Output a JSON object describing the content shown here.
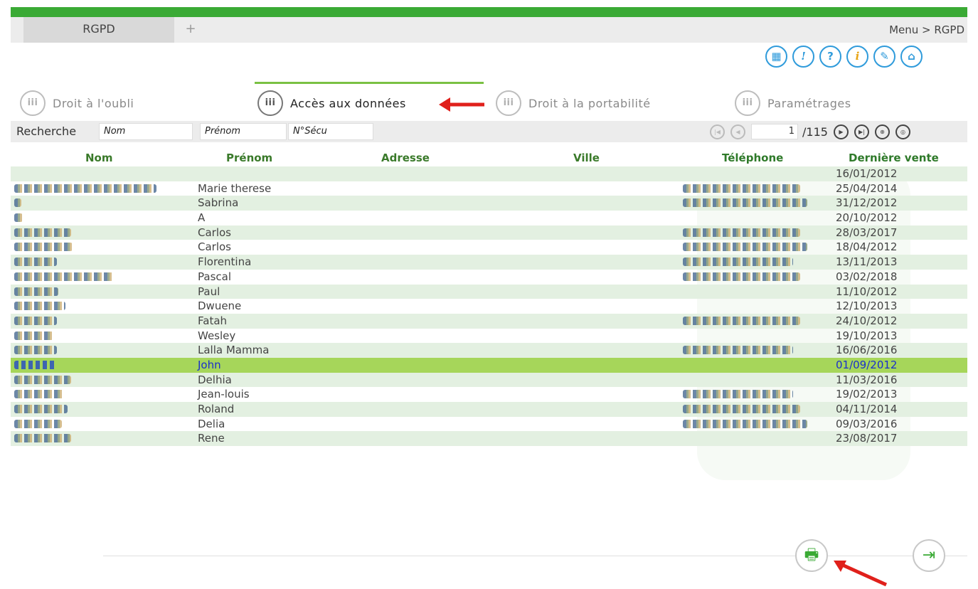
{
  "window": {
    "tab_label": "RGPD",
    "add_tab": "+",
    "breadcrumb": "Menu > RGPD"
  },
  "toolbar_icons": [
    "calendar-icon",
    "alert-icon",
    "help-icon",
    "info-icon",
    "tools-icon",
    "home-icon"
  ],
  "nav_tabs": [
    {
      "label": "Droit à l'oubli",
      "icon": "group-icon",
      "active": false
    },
    {
      "label": "Accès aux données",
      "icon": "group-icon",
      "active": true
    },
    {
      "label": "Droit à la portabilité",
      "icon": "group-icon",
      "active": false
    },
    {
      "label": "Paramétrages",
      "icon": "group-icon",
      "active": false
    }
  ],
  "search": {
    "label": "Recherche",
    "nom_placeholder": "Nom",
    "prenom_placeholder": "Prénom",
    "secu_placeholder": "N°Sécu"
  },
  "pager": {
    "current": "1",
    "total": "/115"
  },
  "table": {
    "columns": [
      "Nom",
      "Prénom",
      "Adresse",
      "Ville",
      "Téléphone",
      "Dernière vente"
    ],
    "rows": [
      {
        "nom": "",
        "prenom": "",
        "tel": "",
        "vente": "16/01/2012"
      },
      {
        "nom": "redacted",
        "prenom": "Marie therese",
        "tel": "redacted",
        "vente": "25/04/2014"
      },
      {
        "nom": "redacted",
        "prenom": "Sabrina",
        "tel": "redacted",
        "vente": "31/12/2012"
      },
      {
        "nom": "redacted",
        "prenom": "A",
        "tel": "",
        "vente": "20/10/2012"
      },
      {
        "nom": "redacted",
        "prenom": "Carlos",
        "tel": "redacted",
        "vente": "28/03/2017"
      },
      {
        "nom": "redacted",
        "prenom": "Carlos",
        "tel": "redacted",
        "vente": "18/04/2012"
      },
      {
        "nom": "redacted",
        "prenom": "Florentina",
        "tel": "redacted",
        "vente": "13/11/2013"
      },
      {
        "nom": "redacted",
        "prenom": "Pascal",
        "tel": "redacted",
        "vente": "03/02/2018"
      },
      {
        "nom": "redacted",
        "prenom": "Paul",
        "tel": "",
        "vente": "11/10/2012"
      },
      {
        "nom": "redacted",
        "prenom": "Dwuene",
        "tel": "",
        "vente": "12/10/2013"
      },
      {
        "nom": "redacted",
        "prenom": "Fatah",
        "tel": "redacted",
        "vente": "24/10/2012"
      },
      {
        "nom": "redacted",
        "prenom": "Wesley",
        "tel": "",
        "vente": "19/10/2013"
      },
      {
        "nom": "redacted",
        "prenom": "Lalla Mamma",
        "tel": "redacted",
        "vente": "16/06/2016"
      },
      {
        "nom": "redacted",
        "prenom": "John",
        "tel": "",
        "vente": "01/09/2012",
        "selected": true
      },
      {
        "nom": "redacted",
        "prenom": "Delhia",
        "tel": "",
        "vente": "11/03/2016"
      },
      {
        "nom": "redacted",
        "prenom": "Jean-louis",
        "tel": "redacted",
        "vente": "19/02/2013"
      },
      {
        "nom": "redacted",
        "prenom": "Roland",
        "tel": "redacted",
        "vente": "04/11/2014"
      },
      {
        "nom": "redacted",
        "prenom": "Delia",
        "tel": "redacted",
        "vente": "09/03/2016"
      },
      {
        "nom": "redacted",
        "prenom": "Rene",
        "tel": "",
        "vente": "23/08/2017"
      }
    ]
  },
  "footer": {
    "print_icon": "printer-icon",
    "exit_icon": "exit-door-icon"
  },
  "colors": {
    "accent_green": "#3aaa35",
    "selected_row": "#a6d65a",
    "icon_blue": "#2f9bdb",
    "annotation_red": "#e0201b"
  }
}
